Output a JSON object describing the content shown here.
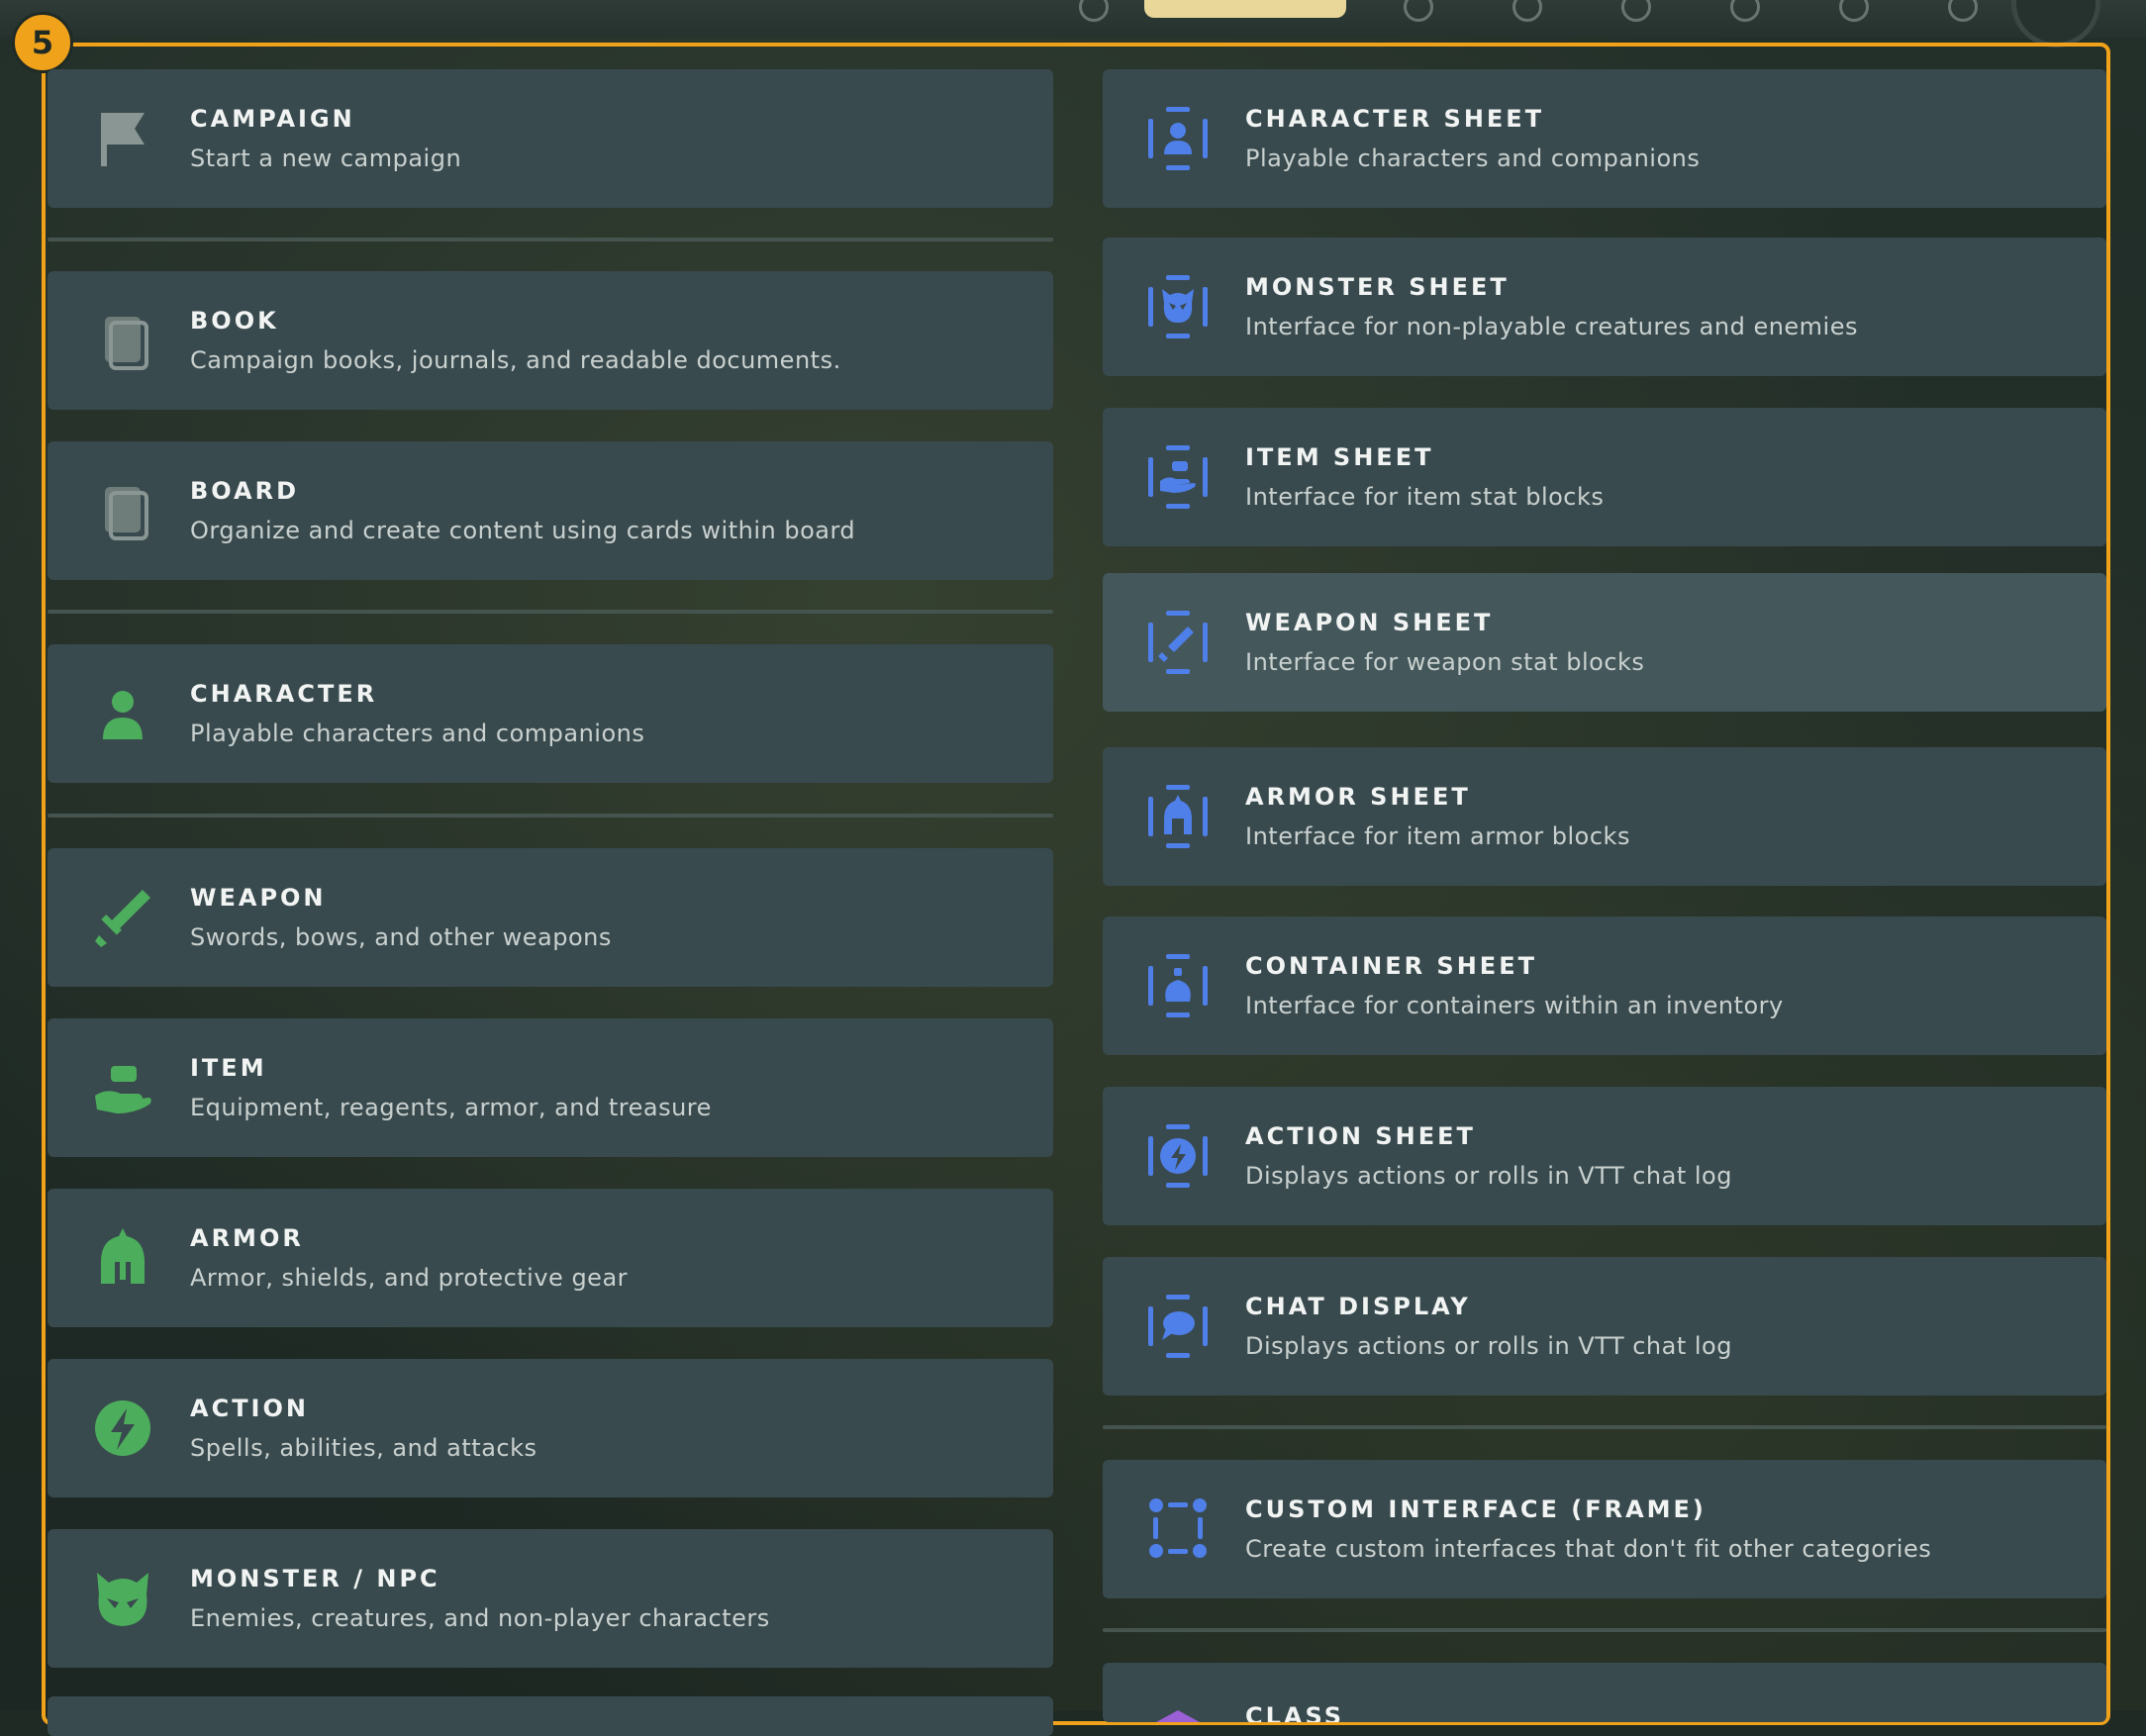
{
  "step_badge": "5",
  "left_items": [
    {
      "title": "CAMPAIGN",
      "desc": "Start a new campaign",
      "icon": "flag-icon"
    },
    {
      "title": "BOOK",
      "desc": "Campaign books, journals, and readable documents.",
      "icon": "book-icon"
    },
    {
      "title": "BOARD",
      "desc": "Organize and create content using cards within board",
      "icon": "board-icon"
    },
    {
      "title": "CHARACTER",
      "desc": "Playable characters and companions",
      "icon": "person-icon"
    },
    {
      "title": "WEAPON",
      "desc": "Swords, bows, and other weapons",
      "icon": "sword-icon"
    },
    {
      "title": "ITEM",
      "desc": "Equipment, reagents, armor, and treasure",
      "icon": "hand-item-icon"
    },
    {
      "title": "ARMOR",
      "desc": "Armor, shields, and protective gear",
      "icon": "helmet-icon"
    },
    {
      "title": "ACTION",
      "desc": "Spells, abilities, and attacks",
      "icon": "lightning-icon"
    },
    {
      "title": "MONSTER / NPC",
      "desc": "Enemies, creatures, and non-player characters",
      "icon": "monster-icon"
    }
  ],
  "right_items": [
    {
      "title": "CHARACTER SHEET",
      "desc": "Playable characters and companions",
      "icon": "character-sheet-icon"
    },
    {
      "title": "MONSTER SHEET",
      "desc": "Interface for non-playable creatures and enemies",
      "icon": "monster-sheet-icon"
    },
    {
      "title": "ITEM SHEET",
      "desc": "Interface for item stat blocks",
      "icon": "item-sheet-icon"
    },
    {
      "title": "WEAPON SHEET",
      "desc": "Interface for weapon stat blocks",
      "icon": "weapon-sheet-icon"
    },
    {
      "title": "ARMOR SHEET",
      "desc": "Interface for item armor blocks",
      "icon": "armor-sheet-icon"
    },
    {
      "title": "CONTAINER SHEET",
      "desc": "Interface for containers within an inventory",
      "icon": "container-sheet-icon"
    },
    {
      "title": "ACTION SHEET",
      "desc": "Displays actions or rolls in VTT chat log",
      "icon": "action-sheet-icon"
    },
    {
      "title": "CHAT DISPLAY",
      "desc": "Displays actions or rolls in VTT chat log",
      "icon": "chat-display-icon"
    },
    {
      "title": "CUSTOM INTERFACE (FRAME)",
      "desc": "Create custom interfaces that don't fit other categories",
      "icon": "frame-icon"
    },
    {
      "title": "CLASS",
      "desc": "",
      "icon": "class-icon"
    }
  ],
  "colors": {
    "accent": "#f0a21a",
    "green_icon": "#4cae5c",
    "blue_icon": "#4f7fe8",
    "grey_icon": "#8a9693",
    "card_bg": "#394a4e",
    "card_hover": "#44575b"
  }
}
